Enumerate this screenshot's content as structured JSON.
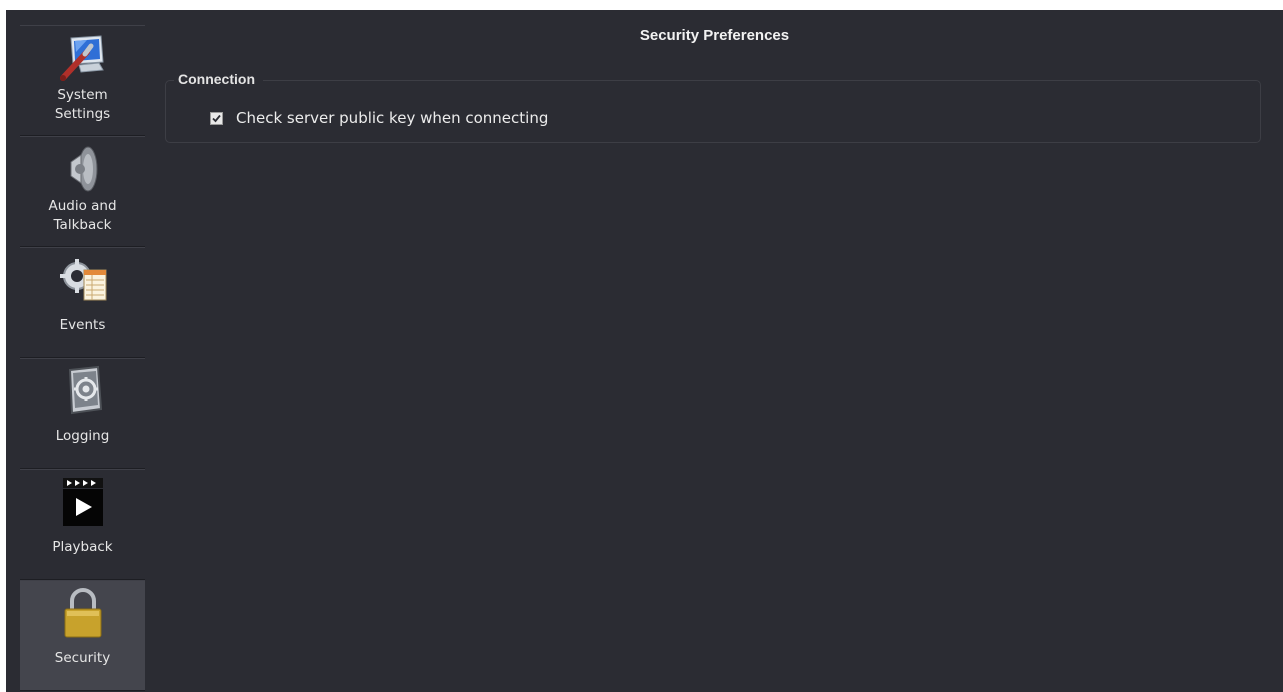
{
  "window": {
    "title": "Security Preferences"
  },
  "sidebar": {
    "items": [
      {
        "label": "System\nSettings",
        "icon": "system-settings-icon",
        "active": false
      },
      {
        "label": "Audio and\nTalkback",
        "icon": "speaker-icon",
        "active": false
      },
      {
        "label": "Events",
        "icon": "events-icon",
        "active": false
      },
      {
        "label": "Logging",
        "icon": "logging-icon",
        "active": false
      },
      {
        "label": "Playback",
        "icon": "playback-icon",
        "active": false
      },
      {
        "label": "Security",
        "icon": "padlock-icon",
        "active": true
      }
    ]
  },
  "connection": {
    "legend": "Connection",
    "check_server_key": {
      "label": "Check server public key when connecting",
      "checked": true
    }
  },
  "colors": {
    "background": "#2b2c33",
    "active_item": "#44454d",
    "text": "#e6e6e6"
  }
}
